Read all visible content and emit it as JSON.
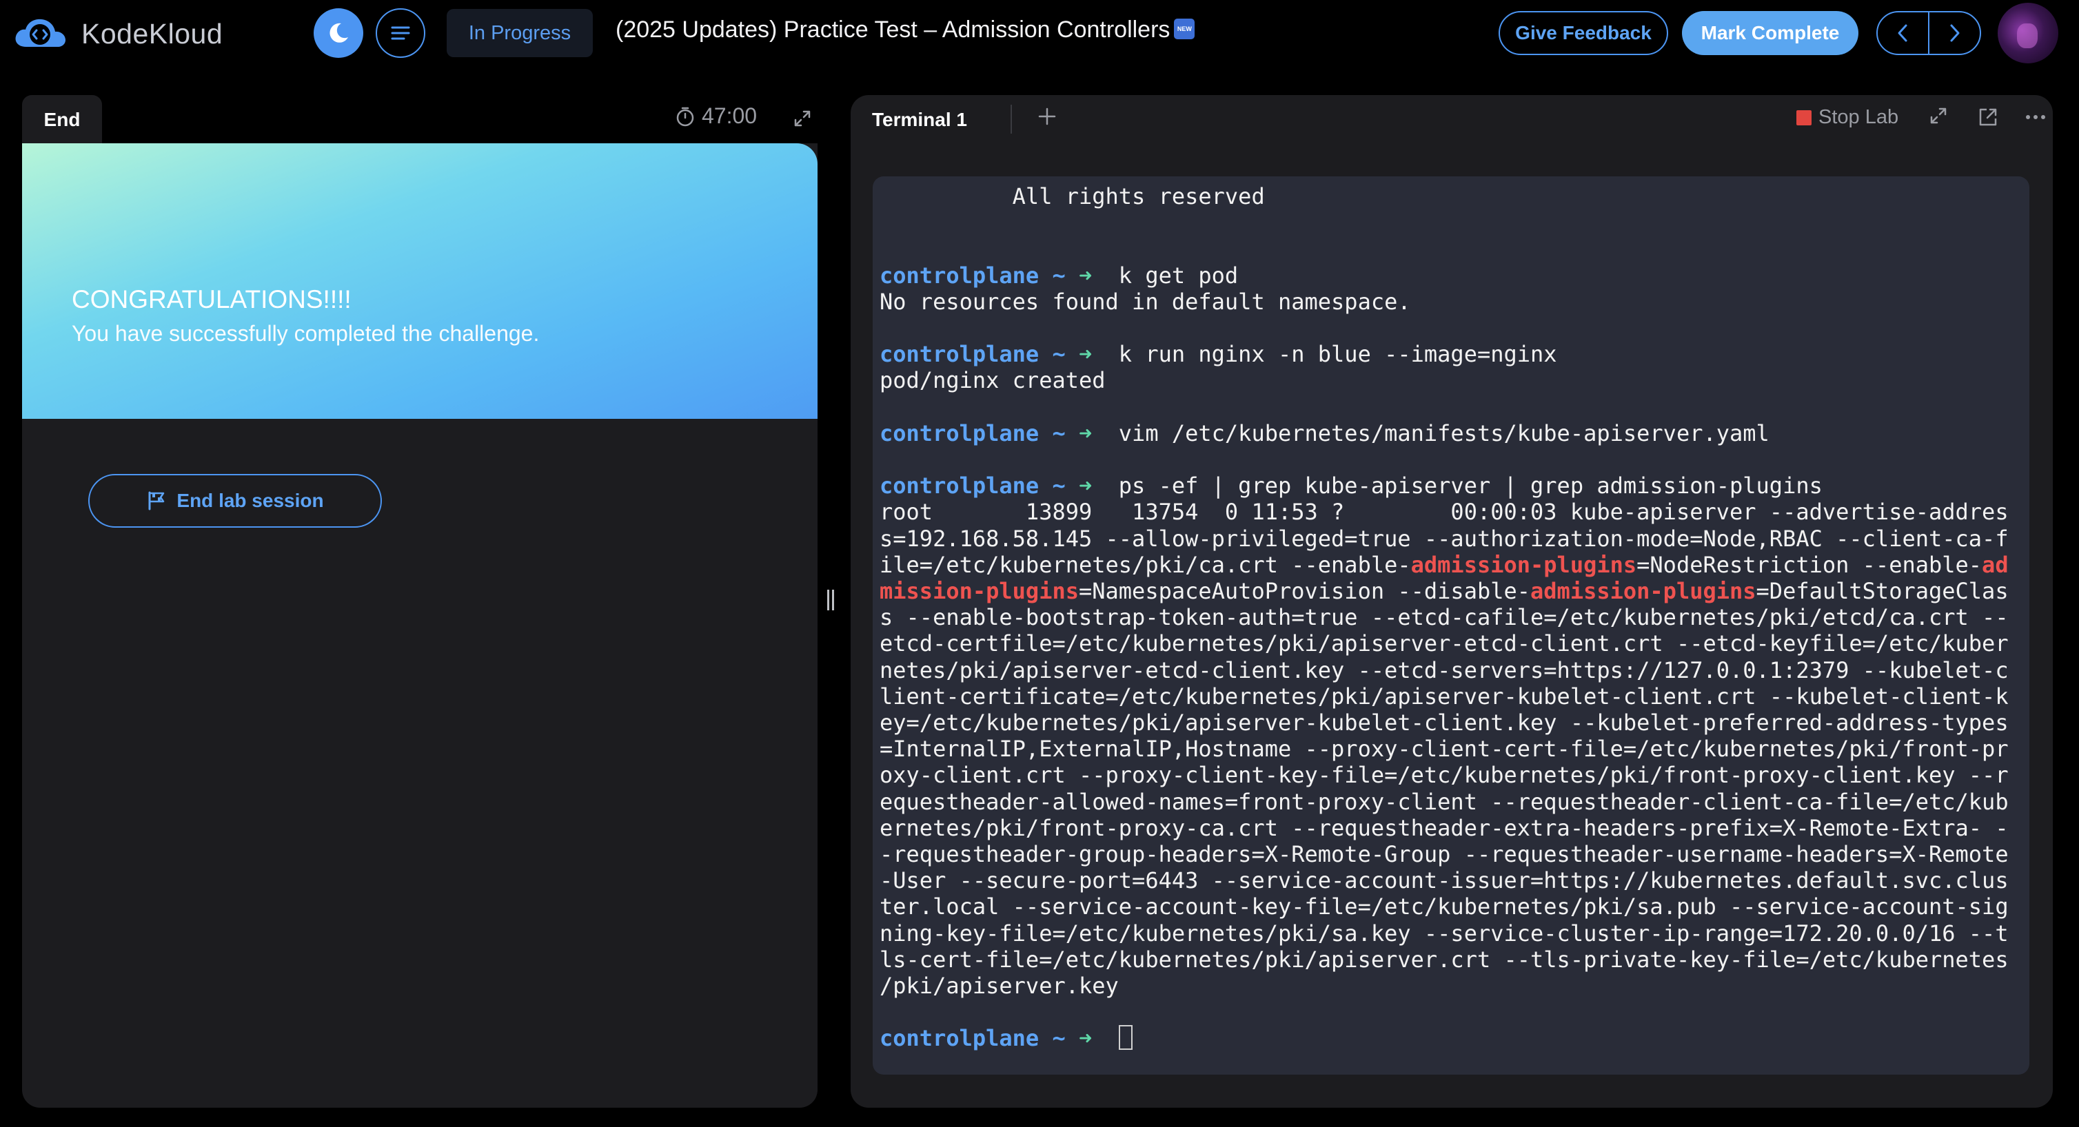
{
  "header": {
    "logo_text": "KodeKloud",
    "status": "In Progress",
    "title": "(2025 Updates) Practice Test – Admission Controllers",
    "new_badge": "NEW",
    "feedback_label": "Give Feedback",
    "complete_label": "Mark Complete",
    "accent_color": "#4c95f2"
  },
  "left_panel": {
    "tab_label": "End",
    "timer": "47:00",
    "congrats_title": "CONGRATULATIONS!!!!",
    "congrats_text": "You have successfully completed the challenge.",
    "end_button_label": "End lab session"
  },
  "terminal": {
    "tab_label": "Terminal 1",
    "stop_label": "Stop Lab",
    "prompt_host": "controlplane",
    "prompt_dir": "~",
    "prompt_arrow": "➜",
    "lines": [
      "          All rights reserved",
      "",
      "",
      "controlplane ~ ➜  k get pod",
      "No resources found in default namespace.",
      "",
      "controlplane ~ ➜  k run nginx -n blue --image=nginx",
      "pod/nginx created",
      "",
      "controlplane ~ ➜  vim /etc/kubernetes/manifests/kube-apiserver.yaml",
      "",
      "controlplane ~ ➜  ps -ef | grep kube-apiserver | grep admission-plugins",
      "root       13899   13754  0 11:53 ?        00:00:03 kube-apiserver --advertise-addres",
      "s=192.168.58.145 --allow-privileged=true --authorization-mode=Node,RBAC --client-ca-f",
      "ile=/etc/kubernetes/pki/ca.crt --enable-admission-plugins=NodeRestriction --enable-ad",
      "mission-plugins=NamespaceAutoProvision --disable-admission-plugins=DefaultStorageClas",
      "s --enable-bootstrap-token-auth=true --etcd-cafile=/etc/kubernetes/pki/etcd/ca.crt --",
      "etcd-certfile=/etc/kubernetes/pki/apiserver-etcd-client.crt --etcd-keyfile=/etc/kuber",
      "netes/pki/apiserver-etcd-client.key --etcd-servers=https://127.0.0.1:2379 --kubelet-c",
      "lient-certificate=/etc/kubernetes/pki/apiserver-kubelet-client.crt --kubelet-client-k",
      "ey=/etc/kubernetes/pki/apiserver-kubelet-client.key --kubelet-preferred-address-types",
      "=InternalIP,ExternalIP,Hostname --proxy-client-cert-file=/etc/kubernetes/pki/front-pr",
      "oxy-client.crt --proxy-client-key-file=/etc/kubernetes/pki/front-proxy-client.key --r",
      "equestheader-allowed-names=front-proxy-client --requestheader-client-ca-file=/etc/kub",
      "ernetes/pki/front-proxy-ca.crt --requestheader-extra-headers-prefix=X-Remote-Extra- -",
      "-requestheader-group-headers=X-Remote-Group --requestheader-username-headers=X-Remote",
      "-User --secure-port=6443 --service-account-issuer=https://kubernetes.default.svc.clus",
      "ter.local --service-account-key-file=/etc/kubernetes/pki/sa.pub --service-account-sig",
      "ning-key-file=/etc/kubernetes/pki/sa.key --service-cluster-ip-range=172.20.0.0/16 --t",
      "ls-cert-file=/etc/kubernetes/pki/apiserver.crt --tls-private-key-file=/etc/kubernetes",
      "/pki/apiserver.key",
      "",
      "controlplane ~ ➜  "
    ],
    "highlight_terms": [
      "admission-plugins",
      "ad",
      "mission-plugins"
    ]
  }
}
